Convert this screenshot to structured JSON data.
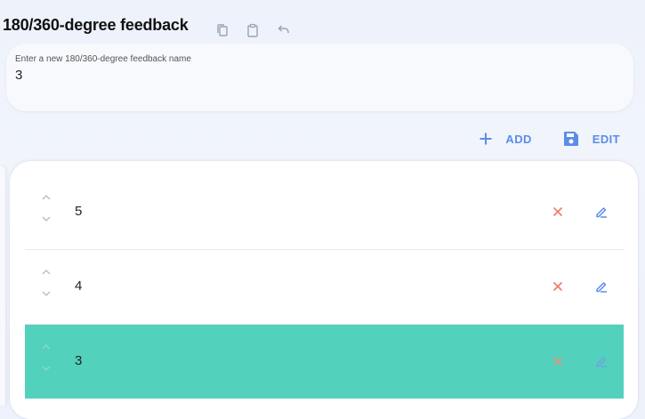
{
  "header": {
    "title": "180/360-degree feedback",
    "tools": [
      {
        "icon": "copy-icon"
      },
      {
        "icon": "paste-icon"
      },
      {
        "icon": "undo-icon"
      }
    ]
  },
  "name_field": {
    "label": "Enter a new 180/360-degree feedback name",
    "value": "3"
  },
  "actions": {
    "add_label": "ADD",
    "edit_label": "EDIT",
    "accent_color": "#5b8de8"
  },
  "list": {
    "items": [
      {
        "value": "5",
        "selected": false
      },
      {
        "value": "4",
        "selected": false
      },
      {
        "value": "3",
        "selected": true
      }
    ],
    "selected_color": "#52d1bc",
    "delete_color": "#ee7b6c",
    "edit_color": "#5b8de8"
  }
}
